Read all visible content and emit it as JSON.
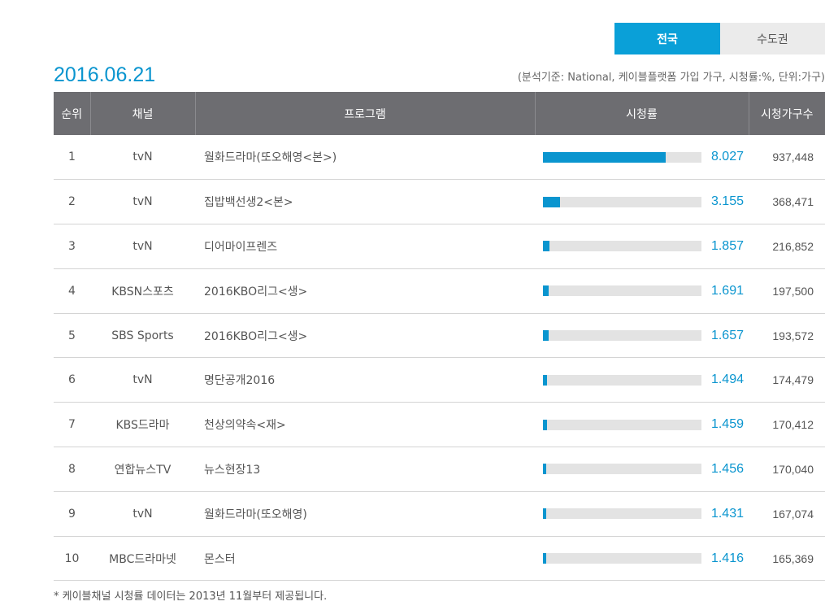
{
  "tabs": [
    {
      "label": "전국",
      "active": true
    },
    {
      "label": "수도권",
      "active": false
    }
  ],
  "date": "2016.06.21",
  "criteria": "(분석기준: National, 케이블플랫폼 가입 가구, 시청률:%, 단위:가구)",
  "table": {
    "headers": [
      "순위",
      "채널",
      "프로그램",
      "시청률",
      "시청가구수"
    ],
    "rows": [
      {
        "rank": "1",
        "channel": "tvN",
        "program": "월화드라마(또오해영<본>)",
        "rating": "8.027",
        "households": "937,448"
      },
      {
        "rank": "2",
        "channel": "tvN",
        "program": "집밥백선생2<본>",
        "rating": "3.155",
        "households": "368,471"
      },
      {
        "rank": "3",
        "channel": "tvN",
        "program": "디어마이프렌즈",
        "rating": "1.857",
        "households": "216,852"
      },
      {
        "rank": "4",
        "channel": "KBSN스포츠",
        "program": "2016KBO리그<생>",
        "rating": "1.691",
        "households": "197,500"
      },
      {
        "rank": "5",
        "channel": "SBS Sports",
        "program": "2016KBO리그<생>",
        "rating": "1.657",
        "households": "193,572"
      },
      {
        "rank": "6",
        "channel": "tvN",
        "program": "명단공개2016",
        "rating": "1.494",
        "households": "174,479"
      },
      {
        "rank": "7",
        "channel": "KBS드라마",
        "program": "천상의약속<재>",
        "rating": "1.459",
        "households": "170,412"
      },
      {
        "rank": "8",
        "channel": "연합뉴스TV",
        "program": "뉴스현장13",
        "rating": "1.456",
        "households": "170,040"
      },
      {
        "rank": "9",
        "channel": "tvN",
        "program": "월화드라마(또오해영)",
        "rating": "1.431",
        "households": "167,074"
      },
      {
        "rank": "10",
        "channel": "MBC드라마넷",
        "program": "몬스터",
        "rating": "1.416",
        "households": "165,369"
      }
    ]
  },
  "bar_fill_fractions": [
    0.775,
    0.11,
    0.04,
    0.035,
    0.035,
    0.028,
    0.026,
    0.022,
    0.022,
    0.02
  ],
  "note": "* 케이블채널 시청률 데이터는 2013년 11월부터 제공됩니다.",
  "colors": {
    "accent": "#0aa0d8",
    "header_bg": "#6d6d71",
    "bar_track": "#e3e3e3"
  }
}
